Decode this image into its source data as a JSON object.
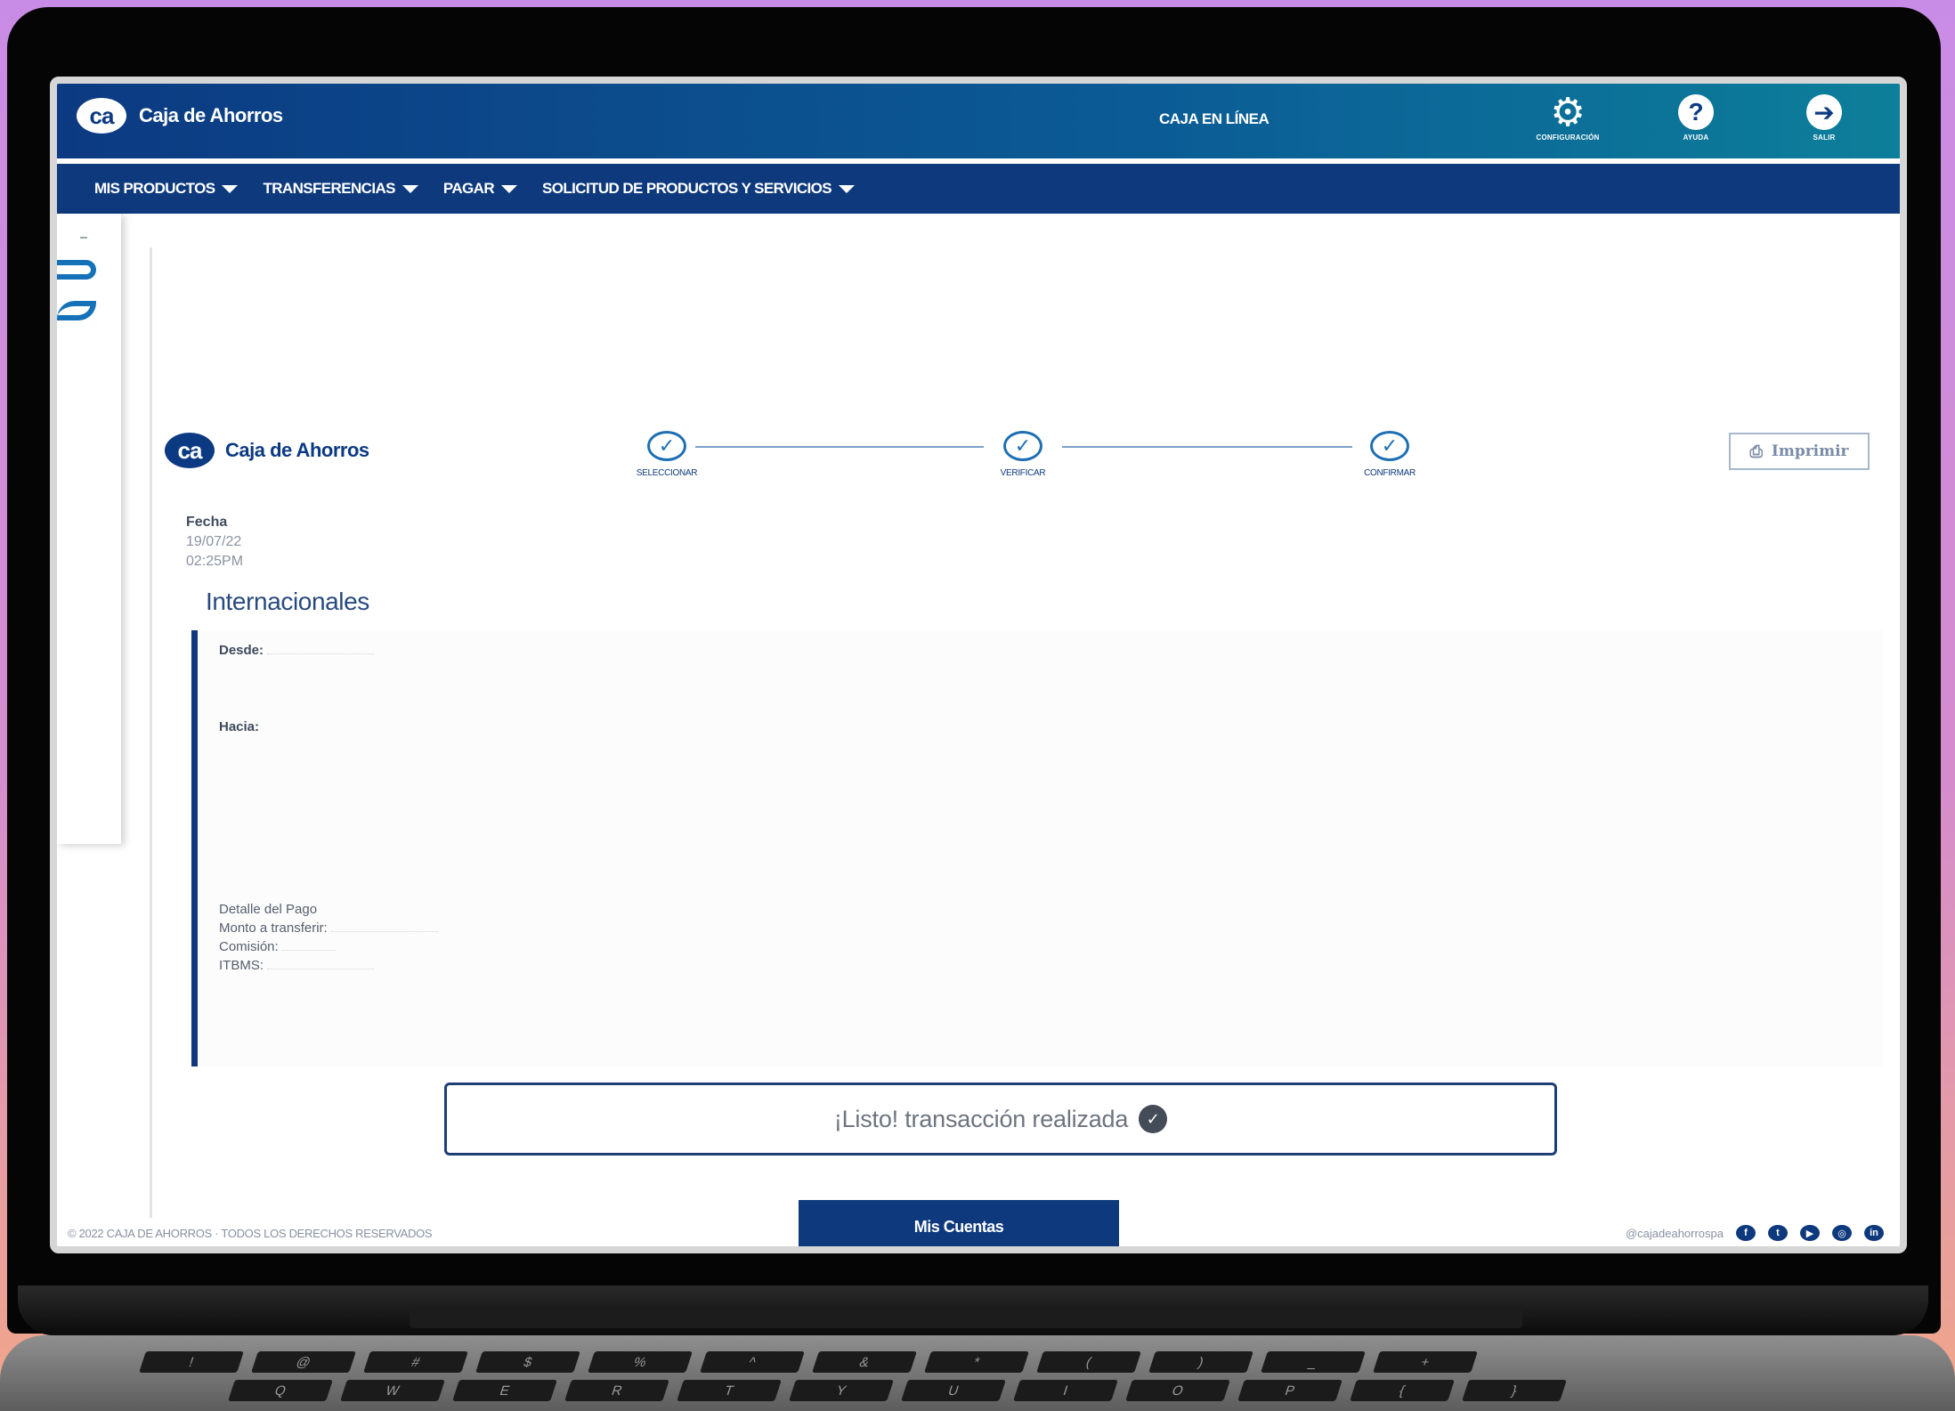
{
  "header": {
    "brand": "Caja de Ahorros",
    "logo": "ca",
    "center_title": "CAJA EN LÍNEA",
    "icons": [
      {
        "name": "gear-icon",
        "glyph": "⚙",
        "caption": "CONFIGURACIÓN"
      },
      {
        "name": "help-icon",
        "glyph": "?",
        "caption": "AYUDA"
      },
      {
        "name": "logout-icon",
        "glyph": "➔",
        "caption": "SALIR"
      }
    ]
  },
  "nav": [
    {
      "label": "MIS PRODUCTOS"
    },
    {
      "label": "TRANSFERENCIAS"
    },
    {
      "label": "PAGAR"
    },
    {
      "label": "SOLICITUD DE PRODUCTOS Y SERVICIOS"
    }
  ],
  "receipt": {
    "brand": "Caja de Ahorros",
    "logo": "ca",
    "steps": [
      {
        "label": "SELECCIONAR"
      },
      {
        "label": "VERIFICAR"
      },
      {
        "label": "CONFIRMAR"
      }
    ],
    "print_label": "Imprimir",
    "date_label": "Fecha",
    "date_value": "19/07/22",
    "time_value": "02:25PM",
    "section_title": "Internacionales",
    "from_label": "Desde:",
    "to_label": "Hacia:",
    "payment_detail_label": "Detalle del Pago",
    "amount_label": "Monto a transferir:",
    "commission_label": "Comisión:",
    "itbms_label": "ITBMS:",
    "status_message": "¡Listo! transacción realizada",
    "primary_button": "Mis Cuentas"
  },
  "footer": {
    "copyright": "© 2022 CAJA DE AHORROS · TODOS LOS DERECHOS RESERVADOS",
    "social_handle": "@cajadeahorrospa",
    "social_icons": [
      "facebook-icon",
      "twitter-icon",
      "youtube-icon",
      "instagram-icon",
      "linkedin-icon"
    ]
  },
  "colors": {
    "primary": "#0e3a7d",
    "accent": "#1d6fb2",
    "background_gradient_top": "#c98ce6",
    "background_gradient_bottom": "#f0a688"
  }
}
